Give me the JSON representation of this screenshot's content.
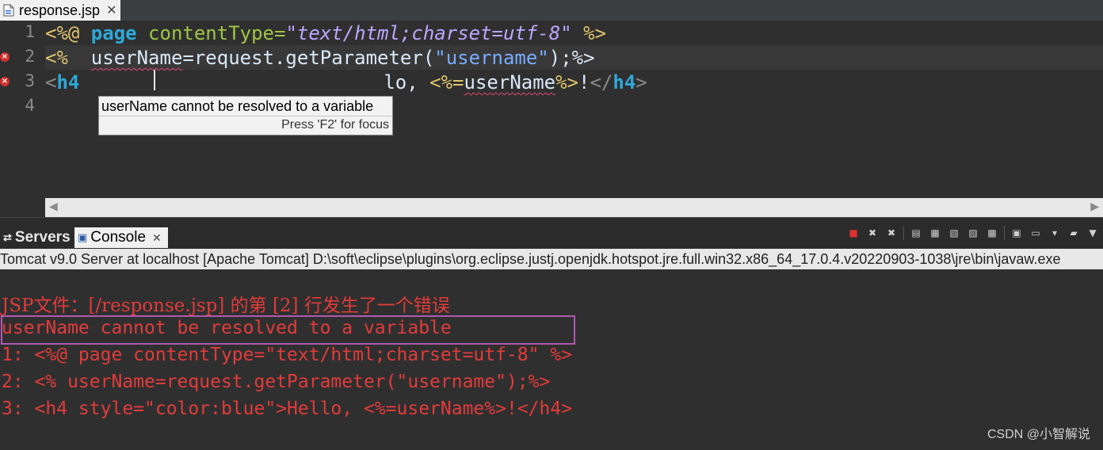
{
  "editor": {
    "tab_label": "response.jsp",
    "line_numbers": [
      "1",
      "2",
      "3",
      "4"
    ],
    "line1": {
      "open": "<%@ ",
      "directive": "page ",
      "attr": "contentType",
      "eq": "=",
      "value": "\"text/html;charset=utf-8\"",
      "close": " %>"
    },
    "line2": {
      "open": "<%  ",
      "var": "userName",
      "rest": "=request.getParameter(",
      "arg": "\"username\"",
      "end": ");%>"
    },
    "line3": {
      "lt": "<",
      "tag": "h4",
      "tail": "lo, ",
      "expr_open": "<%=",
      "expr_var": "userName",
      "expr_close": "%>",
      "bang": "!",
      "close_lt": "</",
      "close_tag": "h4",
      "close_gt": ">"
    },
    "tooltip": {
      "message": "userName cannot be resolved to a variable",
      "hint": "Press 'F2' for focus"
    }
  },
  "panel": {
    "tabs": [
      {
        "label": "Servers"
      },
      {
        "label": "Console"
      }
    ],
    "console_title": "Tomcat v9.0 Server at localhost [Apache Tomcat] D:\\soft\\eclipse\\plugins\\org.eclipse.justj.openjdk.hotspot.jre.full.win32.x86_64_17.0.4.v20220903-1038\\jre\\bin\\javaw.exe",
    "output_lines": [
      "JSP文件：[/response.jsp] 的第 [2] 行发生了一个错误",
      "userName cannot be resolved to a variable",
      "1: <%@ page contentType=\"text/html;charset=utf-8\" %>",
      "2: <% userName=request.getParameter(\"username\");%>",
      "3: <h4 style=\"color:blue\">Hello, <%=userName%>!</h4>"
    ]
  },
  "watermark": "CSDN @小智解说",
  "colors": {
    "editor_bg": "#2f2f2f",
    "error_text": "#e23b3b",
    "highlight_box": "#b05ab0",
    "keyword": "#2fa8d8",
    "string": "#b9a7ff"
  }
}
